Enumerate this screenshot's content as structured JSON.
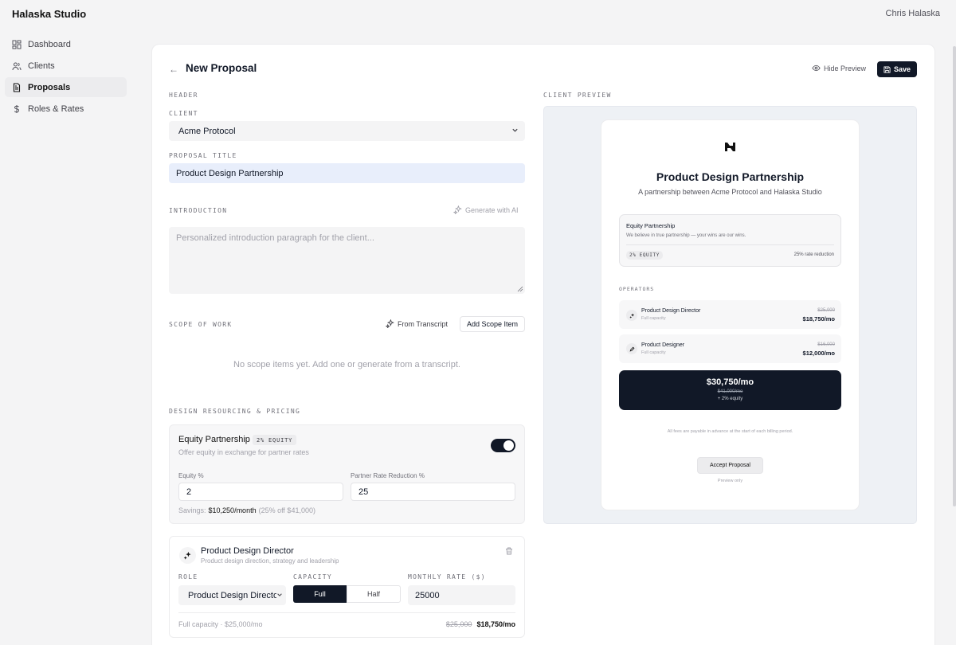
{
  "app": {
    "brand": "Halaska Studio",
    "user": "Chris Halaska"
  },
  "sidebar": {
    "items": [
      {
        "label": "Dashboard",
        "icon": "grid-icon"
      },
      {
        "label": "Clients",
        "icon": "users-icon"
      },
      {
        "label": "Proposals",
        "icon": "document-icon",
        "active": true
      },
      {
        "label": "Roles & Rates",
        "icon": "dollar-icon"
      }
    ]
  },
  "header": {
    "title": "New Proposal",
    "back": "←",
    "hide_preview": "Hide Preview",
    "save": "Save"
  },
  "form": {
    "header_section": "HEADER",
    "client_label": "CLIENT",
    "client_value": "Acme Protocol",
    "title_label": "PROPOSAL TITLE",
    "title_value": "Product Design Partnership",
    "intro_label": "INTRODUCTION",
    "generate_ai": "Generate with AI",
    "intro_placeholder": "Personalized introduction paragraph for the client...",
    "scope_label": "SCOPE OF WORK",
    "from_transcript": "From Transcript",
    "add_scope": "Add Scope Item",
    "scope_empty": "No scope items yet. Add one or generate from a transcript.",
    "pricing_label": "DESIGN RESOURCING & PRICING"
  },
  "equity": {
    "title": "Equity Partnership",
    "badge": "2% EQUITY",
    "subtitle": "Offer equity in exchange for partner rates",
    "enabled": true,
    "equity_label": "Equity %",
    "equity_value": "2",
    "reduction_label": "Partner Rate Reduction %",
    "reduction_value": "25",
    "savings_label": "Savings:",
    "savings_value": "$10,250/month",
    "savings_detail": "(25% off $41,000)"
  },
  "role": {
    "title": "Product Design Director",
    "subtitle": "Product design direction, strategy and leadership",
    "role_label": "ROLE",
    "role_value": "Product Design Director",
    "capacity_label": "CAPACITY",
    "capacity_full": "Full",
    "capacity_half": "Half",
    "rate_label": "MONTHLY RATE ($)",
    "rate_value": "25000",
    "footer": "Full capacity · $25,000/mo",
    "price_old": "$25,000",
    "price_new": "$18,750/mo"
  },
  "preview": {
    "section_label": "CLIENT PREVIEW",
    "title": "Product Design Partnership",
    "subtitle": "A partnership between Acme Protocol and Halaska Studio",
    "equity_title": "Equity Partnership",
    "equity_sub": "We believe in true partnership — your wins are our wins.",
    "equity_badge": "2% EQUITY",
    "equity_rate": "25% rate reduction",
    "operators_label": "OPERATORS",
    "operators": [
      {
        "name": "Product Design Director",
        "capacity": "Full capacity",
        "old": "$25,000",
        "new": "$18,750/mo"
      },
      {
        "name": "Product Designer",
        "capacity": "Full capacity",
        "old": "$16,000",
        "new": "$12,000/mo"
      }
    ],
    "total": "$30,750/mo",
    "total_old": "$41,000/mo",
    "total_equity": "+ 2% equity",
    "note": "All fees are payable in advance at the start of each billing period.",
    "accept": "Accept Proposal",
    "preview_only": "Preview only"
  },
  "colors": {
    "primary": "#111827",
    "muted": "#a1a1aa",
    "preview_bg": "#eef1f5"
  }
}
